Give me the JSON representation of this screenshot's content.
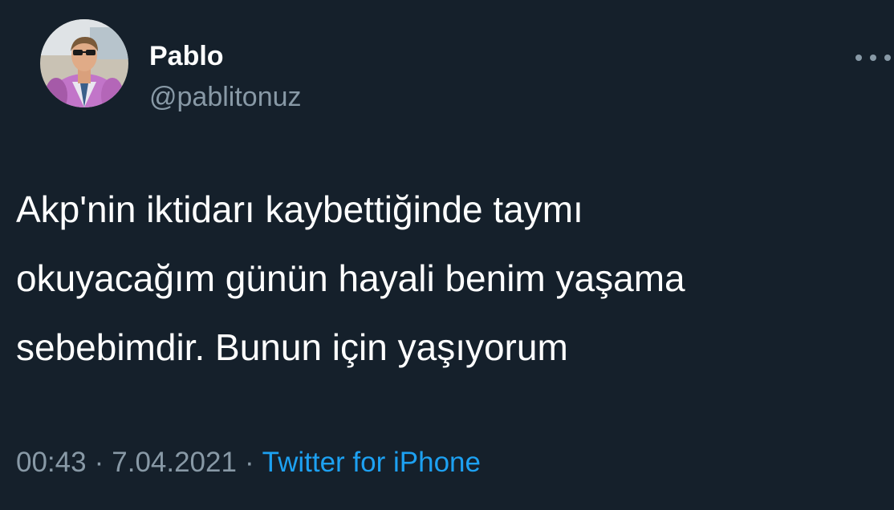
{
  "author": {
    "name": "Pablo",
    "handle": "@pablitonuz",
    "avatar_icon": "profile-photo"
  },
  "tweet": {
    "lines": [
      "Akp'nin iktidarı kaybettiğinde taymı",
      "okuyacağım günün hayali benim yaşama",
      "sebebimdir. Bunun için yaşıyorum"
    ]
  },
  "meta": {
    "time": "00:43",
    "separator": "·",
    "date": "7.04.2021",
    "source": "Twitter for iPhone"
  },
  "menu": {
    "icon": "more-horizontal-icon"
  },
  "colors": {
    "background": "#15202B",
    "primary_text": "#FFFFFF",
    "secondary_text": "#8899A6",
    "link": "#1DA1F2"
  }
}
